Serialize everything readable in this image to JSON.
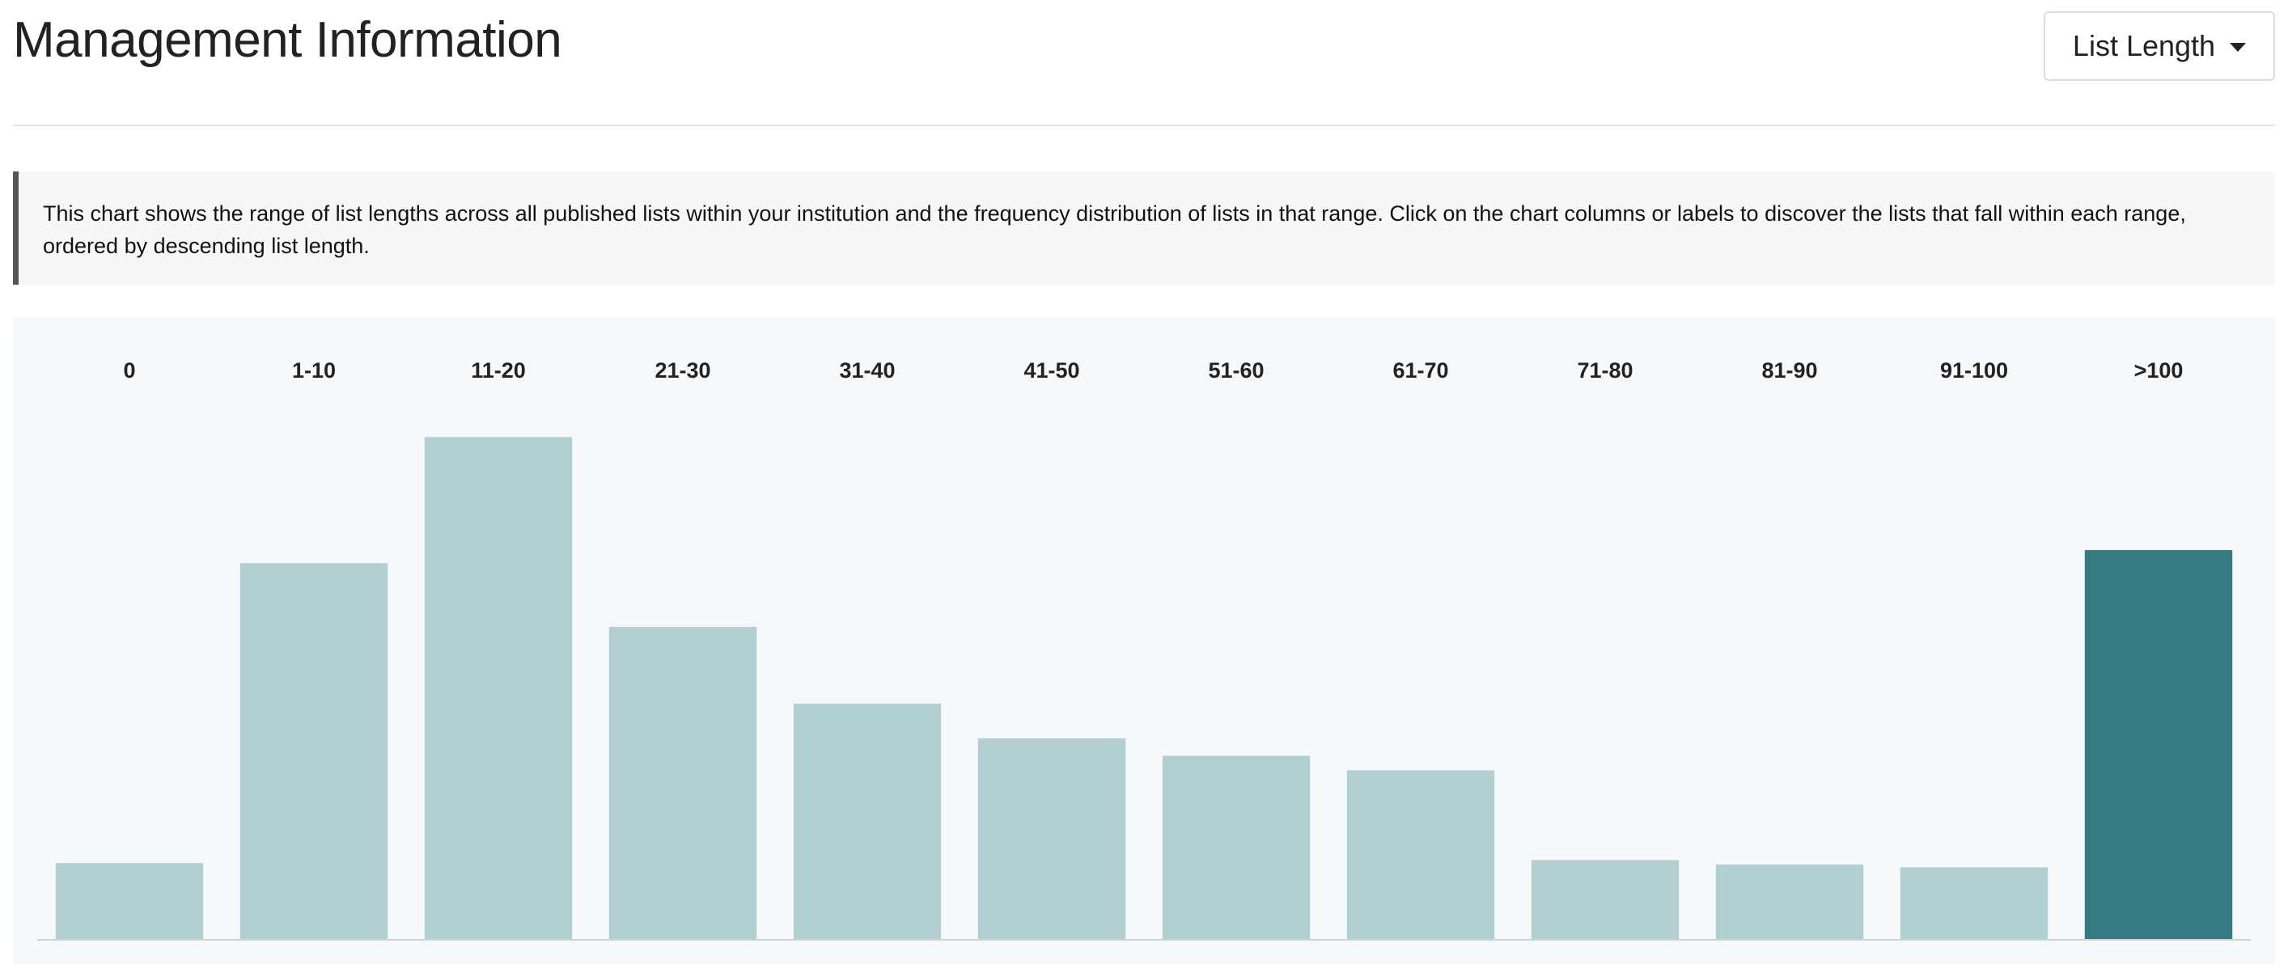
{
  "header": {
    "title": "Management Information",
    "dropdown_label": "List Length"
  },
  "info": {
    "text": "This chart shows the range of list lengths across all published lists within your institution and the frequency distribution of lists in that range. Click on the chart columns or labels to discover the lists that fall within each range, ordered by descending list length."
  },
  "colors": {
    "bar": "#b2cfd2",
    "bar_highlight": "#367a82",
    "baseline": "#c9d3d8"
  },
  "chart_data": {
    "type": "bar",
    "categories": [
      "0",
      "1-10",
      "11-20",
      "21-30",
      "31-40",
      "41-50",
      "51-60",
      "61-70",
      "71-80",
      "81-90",
      "91-100",
      ">100"
    ],
    "values": [
      53,
      260,
      347,
      216,
      163,
      139,
      127,
      117,
      55,
      52,
      50,
      269
    ],
    "highlighted_index": 11,
    "ylim": [
      0,
      350
    ],
    "grid": false,
    "legend": "none",
    "category_labels_position": "top"
  }
}
